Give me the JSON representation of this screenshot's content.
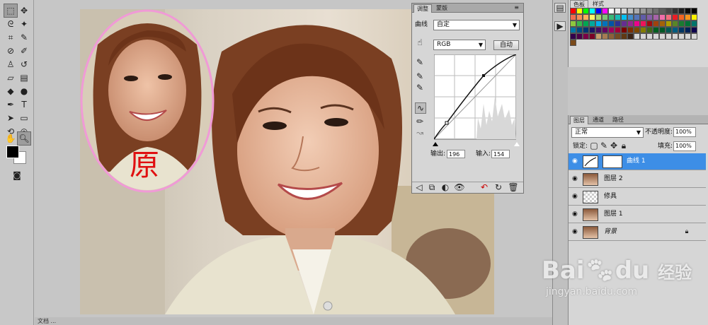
{
  "canvas": {
    "annotation_char": "原",
    "status_text": "文档 ..."
  },
  "adjustments": {
    "tabs": [
      {
        "label": "调整"
      },
      {
        "label": "蒙版"
      }
    ],
    "preset_label": "曲线",
    "preset_value": "自定",
    "channel_value": "RGB",
    "auto_button": "自动",
    "output_label": "输出:",
    "output_value": "196",
    "input_label": "输入:",
    "input_value": "154"
  },
  "swatches": {
    "tabs": [
      {
        "label": "色板"
      },
      {
        "label": "样式"
      }
    ],
    "colors": [
      "#ff0000",
      "#ffff00",
      "#00ff00",
      "#00ffff",
      "#0000ff",
      "#ff00ff",
      "#ffffff",
      "#ebebeb",
      "#d6d6d6",
      "#c2c2c2",
      "#adadad",
      "#999999",
      "#858585",
      "#707070",
      "#5c5c5c",
      "#474747",
      "#333333",
      "#1f1f1f",
      "#0a0a0a",
      "#000000",
      "#f26c4f",
      "#f68e56",
      "#fbaf5c",
      "#fff467",
      "#acd372",
      "#7cc576",
      "#3bb878",
      "#1abbb4",
      "#00bff3",
      "#438ccb",
      "#5574b9",
      "#605ca8",
      "#855fa8",
      "#a763a8",
      "#f06ea9",
      "#f26d7d",
      "#ed1c24",
      "#f26522",
      "#f7941d",
      "#fff200",
      "#8dc73f",
      "#39b54a",
      "#00a651",
      "#00a99d",
      "#00aeef",
      "#0072bc",
      "#0054a6",
      "#2e3192",
      "#662d91",
      "#92278f",
      "#ec008c",
      "#ed145b",
      "#9e0b0f",
      "#a0410d",
      "#a36209",
      "#aba000",
      "#598527",
      "#1a7b30",
      "#007236",
      "#00746b",
      "#0076a3",
      "#004b80",
      "#003471",
      "#1b1464",
      "#440e62",
      "#630460",
      "#9e005d",
      "#9e0039",
      "#790000",
      "#7b2e00",
      "#7d4900",
      "#827b00",
      "#406618",
      "#005e20",
      "#005826",
      "#005952",
      "#005b7f",
      "#003663",
      "#002157",
      "#0d004c",
      "#32004b",
      "#4b0049",
      "#7b0046",
      "#7a0026",
      "#c69c6d",
      "#a67c52",
      "#8c6239",
      "#754c24",
      "#603913",
      "#3c2415",
      "#d6d6d6",
      "#d6d6d6",
      "#d6d6d6",
      "#d6d6d6",
      "#d6d6d6",
      "#d6d6d6",
      "#d6d6d6",
      "#d6d6d6",
      "#d6d6d6",
      "#d6d6d6",
      "#7a4a1a"
    ]
  },
  "layers": {
    "tabs": [
      {
        "label": "图层"
      },
      {
        "label": "通道"
      },
      {
        "label": "路径"
      }
    ],
    "blend_mode": "正常",
    "opacity_label": "不透明度:",
    "opacity_value": "100%",
    "lock_label": "锁定:",
    "fill_label": "填充:",
    "fill_value": "100%",
    "items": [
      {
        "name": "曲线 1",
        "selected": true
      },
      {
        "name": "图层 2"
      },
      {
        "name": "修具"
      },
      {
        "name": "图层 1"
      },
      {
        "name": "背景"
      }
    ]
  },
  "watermark": {
    "brand": "Bai",
    "brand2": "du",
    "suffix": "经验",
    "url": "jingyan.baidu.com"
  }
}
